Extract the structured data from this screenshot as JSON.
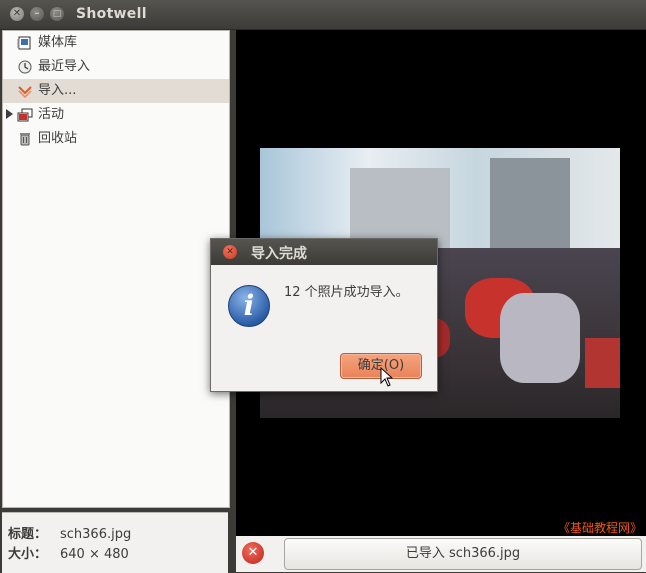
{
  "window": {
    "title": "Shotwell"
  },
  "sidebar": {
    "items": [
      {
        "label": "媒体库",
        "icon": "library-icon"
      },
      {
        "label": "最近导入",
        "icon": "recent-import-icon"
      },
      {
        "label": "导入...",
        "icon": "import-icon",
        "selected": true
      },
      {
        "label": "活动",
        "icon": "events-icon",
        "expandable": true
      },
      {
        "label": "回收站",
        "icon": "trash-icon"
      }
    ]
  },
  "metadata": {
    "title_label": "标题：",
    "title_value": "sch366.jpg",
    "size_label": "大小：",
    "size_value": "640 × 480"
  },
  "status": {
    "stop_icon": "✕",
    "progress_text": "已导入 sch366.jpg"
  },
  "watermark": "《基础教程网》",
  "dialog": {
    "title": "导入完成",
    "message": "12 个照片成功导入。",
    "ok_label": "确定(O)",
    "icon": "info-icon"
  },
  "colors": {
    "accent_button": "#e9825a",
    "selected_row": "#e2dcd4",
    "titlebar": "#3c3b37"
  }
}
